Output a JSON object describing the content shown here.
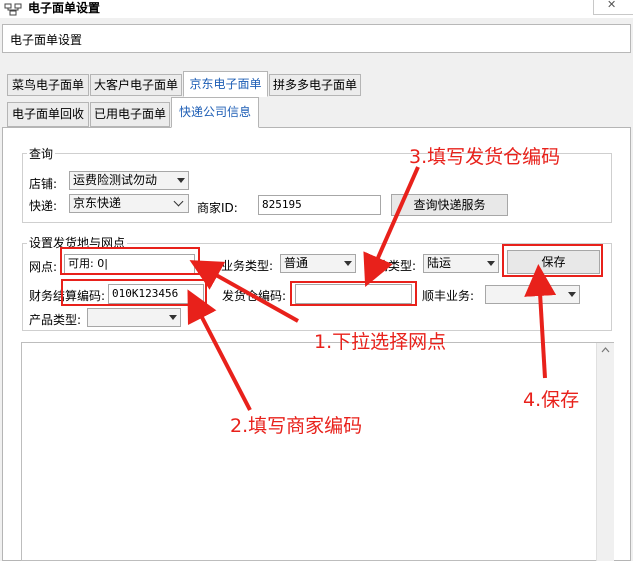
{
  "window": {
    "title": "电子面单设置",
    "header_text": "电子面单设置",
    "close_glyph": "✕"
  },
  "tabs_row1": [
    "菜鸟电子面单",
    "大客户电子面单",
    "京东电子面单",
    "拼多多电子面单"
  ],
  "tabs_row2": [
    "电子面单回收",
    "已用电子面单",
    "快递公司信息"
  ],
  "active_tab": "京东电子面单",
  "query": {
    "legend": "查询",
    "shop_label": "店铺:",
    "shop_value": "运费险测试勿动",
    "express_label": "快递:",
    "express_value": "京东快递",
    "merchant_id_label": "商家ID:",
    "merchant_id_value": "825195",
    "query_button": "查询快递服务"
  },
  "settings": {
    "legend": "设置发货地与网点",
    "outlet_label": "网点:",
    "outlet_value": "可用: 0|",
    "business_type_label": "业务类型:",
    "business_type_value": "普通",
    "transport_type_label": "运输类型:",
    "transport_type_value": "陆运",
    "save_button": "保存",
    "settlement_code_label": "财务结算编码:",
    "settlement_code_value": "010K123456",
    "warehouse_code_label": "发货仓编码:",
    "warehouse_code_value": "",
    "sf_business_label": "顺丰业务:",
    "sf_business_value": "",
    "product_type_label": "产品类型:",
    "product_type_value": ""
  },
  "annotations": {
    "step1": "1.下拉选择网点",
    "step2": "2.填写商家编码",
    "step3": "3.填写发货仓编码",
    "step4": "4.保存",
    "color": "#e8211b"
  }
}
